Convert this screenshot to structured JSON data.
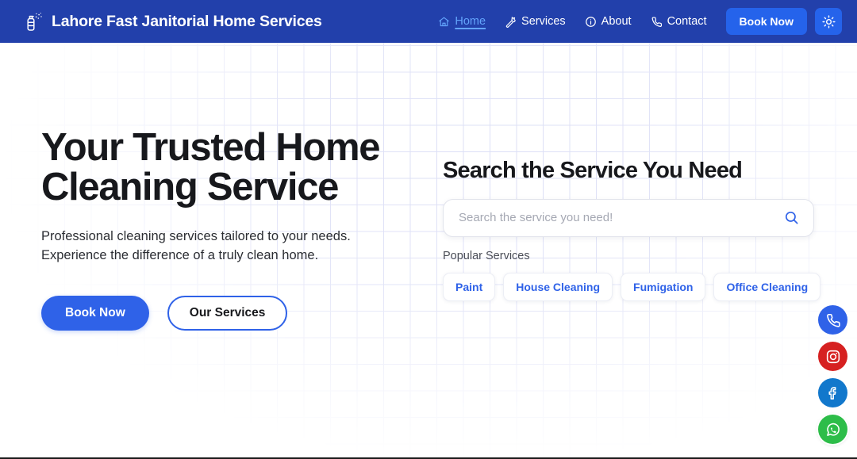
{
  "header": {
    "brand_name": "Lahore Fast Janitorial Home Services",
    "brand_icon": "spray-bottle-icon",
    "nav": [
      {
        "label": "Home",
        "icon": "home-icon",
        "active": true
      },
      {
        "label": "Services",
        "icon": "wrench-icon",
        "active": false
      },
      {
        "label": "About",
        "icon": "info-circle-icon",
        "active": false
      },
      {
        "label": "Contact",
        "icon": "phone-icon",
        "active": false
      }
    ],
    "book_now_label": "Book Now",
    "theme_toggle_icon": "sun-icon"
  },
  "hero": {
    "title_line1": "Your Trusted Home",
    "title_line2": "Cleaning Service",
    "subtitle_line1": "Professional cleaning services tailored to your needs.",
    "subtitle_line2": "Experience the difference of a truly clean home.",
    "primary_cta": "Book Now",
    "secondary_cta": "Our Services"
  },
  "search": {
    "title": "Search the Service You Need",
    "placeholder": "Search the service you need!",
    "value": "",
    "search_icon": "magnifier-icon",
    "popular_label": "Popular Services",
    "chips": [
      "Paint",
      "House Cleaning",
      "Fumigation",
      "Office Cleaning"
    ]
  },
  "socials": [
    {
      "name": "phone",
      "icon": "phone-icon",
      "color": "#2f62e8"
    },
    {
      "name": "instagram",
      "icon": "instagram-icon",
      "color": "#d62121"
    },
    {
      "name": "facebook",
      "icon": "facebook-icon",
      "color": "#1278cc"
    },
    {
      "name": "whatsapp",
      "icon": "whatsapp-icon",
      "color": "#2dbd49"
    }
  ],
  "colors": {
    "header_bg": "#2240ab",
    "accent_blue": "#2f62e8",
    "nav_active": "#63a4fb",
    "text_dark": "#17181c",
    "grid_line": "#d9dcf5"
  }
}
